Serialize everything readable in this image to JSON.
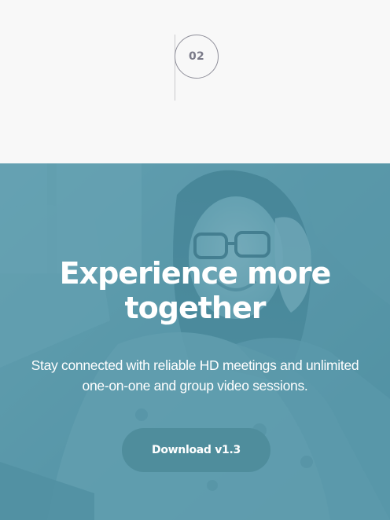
{
  "step": {
    "number": "02"
  },
  "hero": {
    "title_line1": "Experience more",
    "title_line2": "together",
    "subtitle_line1": "Stay connected with reliable HD meetings and unlimited",
    "subtitle_line2": "one-on-one and group video sessions.",
    "download_label": "Download v1.3"
  },
  "colors": {
    "page_background": "#f8f8f8",
    "hero_tint": "#5d9aaa",
    "button_background": "#4f8d9c",
    "text_on_hero": "#ffffff",
    "step_number": "#7a7a88"
  }
}
